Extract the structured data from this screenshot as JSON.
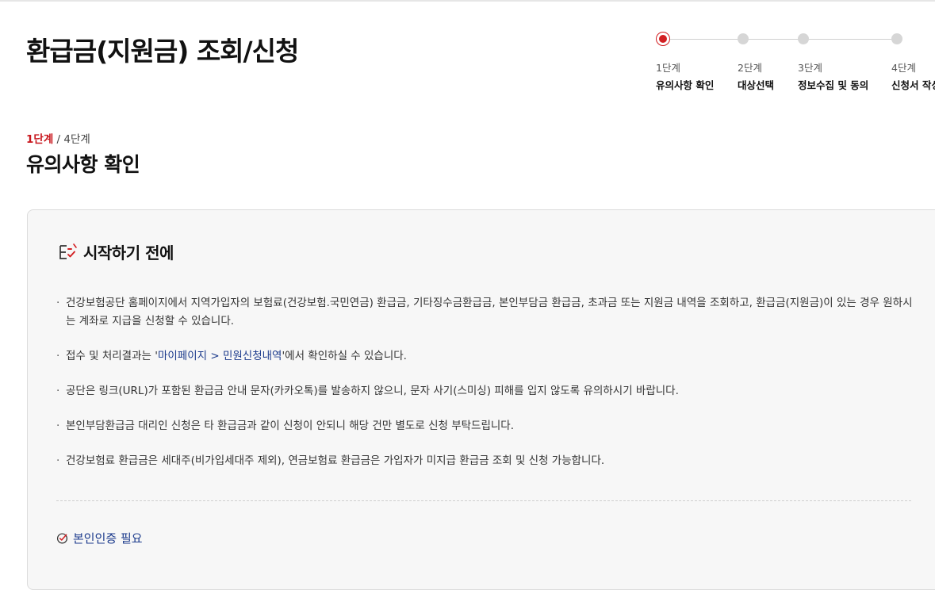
{
  "header": {
    "title": "환급금(지원금) 조회/신청"
  },
  "stepper": {
    "steps": [
      {
        "num": "1단계",
        "name": "유의사항 확인",
        "active": true
      },
      {
        "num": "2단계",
        "name": "대상선택",
        "active": false
      },
      {
        "num": "3단계",
        "name": "정보수집 및 동의",
        "active": false
      },
      {
        "num": "4단계",
        "name": "신청서 작성",
        "active": false
      }
    ]
  },
  "progress": {
    "current": "1단계",
    "separator": "/",
    "total": "4단계"
  },
  "section": {
    "title": "유의사항 확인"
  },
  "notice": {
    "title": "시작하기 전에",
    "items": [
      {
        "text": "건강보험공단 홈페이지에서 지역가입자의 보험료(건강보험.국민연금) 환급금, 기타징수금환급금, 본인부담금 환급금, 초과금 또는 지원금 내역을 조회하고, 환급금(지원금)이 있는 경우 원하시는 계좌로 지급을 신청할 수 있습니다."
      },
      {
        "before": "접수 및 처리결과는 '",
        "link": "마이페이지 > 민원신청내역",
        "after": "'에서 확인하실 수 있습니다."
      },
      {
        "text": "공단은 링크(URL)가 포함된 환급금 안내 문자(카카오톡)를 발송하지 않으니, 문자 사기(스미싱) 피해를 입지 않도록 유의하시기 바랍니다."
      },
      {
        "text": "본인부담환급금 대리인 신청은 타 환급금과 같이 신청이 안되니 해당 건만 별도로 신청 부탁드립니다."
      },
      {
        "text": "건강보험료 환급금은 세대주(비가입세대주 제외), 연금보험료 환급금은 가입자가 미지급 환급금 조회 및 신청 가능합니다."
      }
    ],
    "verify_label": "본인인증 필요"
  },
  "colors": {
    "accent_red": "#c8161d",
    "link_blue": "#1b3a8c"
  },
  "icons": {
    "notice": "checklist-icon",
    "verify": "check-circle-icon"
  }
}
